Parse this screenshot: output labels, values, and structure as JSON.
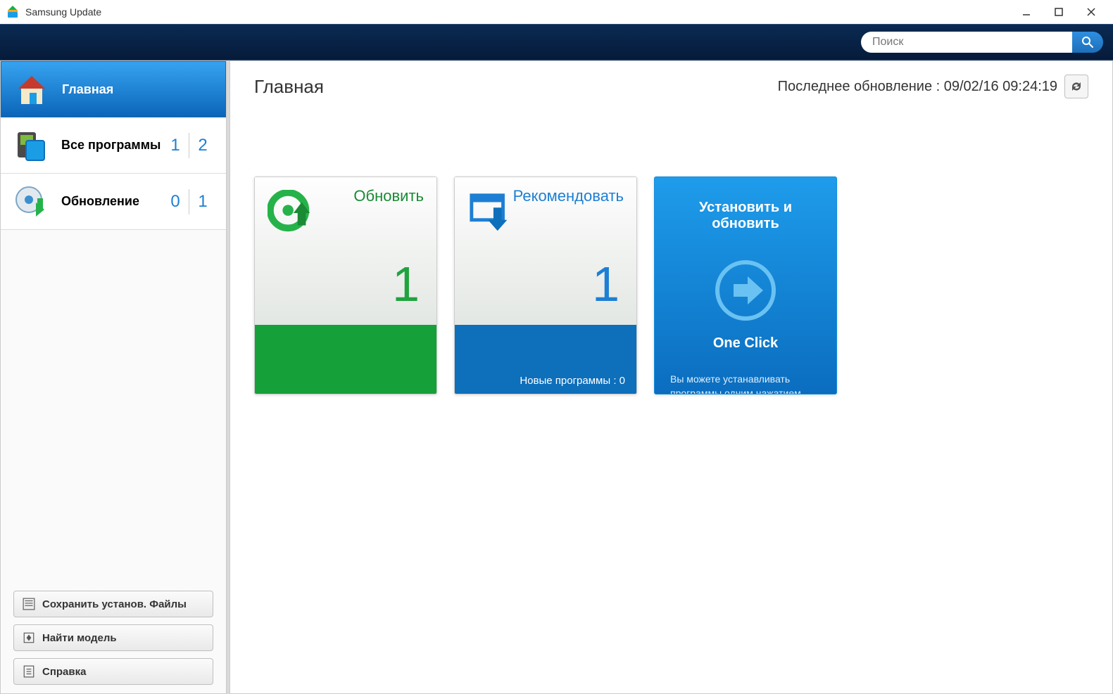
{
  "titlebar": {
    "title": "Samsung Update"
  },
  "search": {
    "placeholder": "Поиск"
  },
  "sidebar": {
    "items": [
      {
        "label": "Главная",
        "n1": "",
        "n2": ""
      },
      {
        "label": "Все программы",
        "n1": "1",
        "n2": "2"
      },
      {
        "label": "Обновление",
        "n1": "0",
        "n2": "1"
      }
    ],
    "buttons": {
      "save": "Сохранить установ. Файлы",
      "find": "Найти модель",
      "help": "Справка"
    }
  },
  "main": {
    "title": "Главная",
    "last_update_label": "Последнее обновление : 09/02/16 09:24:19",
    "cards": {
      "update": {
        "title": "Обновить",
        "count": "1"
      },
      "recommend": {
        "title": "Рекомендовать",
        "count": "1",
        "footer": "Новые программы : 0"
      },
      "action": {
        "title": "Установить и обновить",
        "oneclick": "One Click",
        "desc": "Вы можете устанавливать программы одним нажатием кнопки"
      }
    }
  }
}
